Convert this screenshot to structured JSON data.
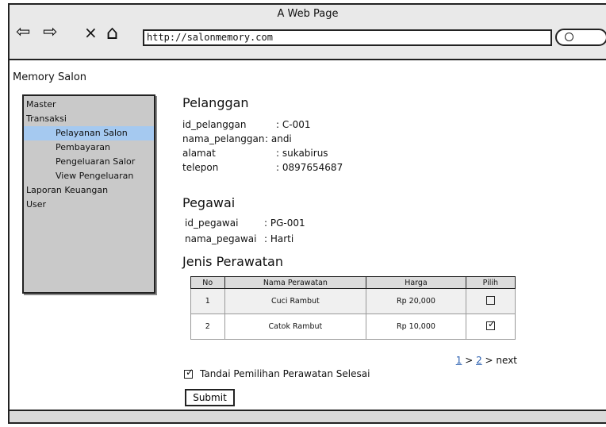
{
  "window": {
    "title": "A Web Page",
    "url": "http://salonmemory.com"
  },
  "icons": {
    "back": "arrow-left-icon",
    "forward": "arrow-right-icon",
    "stop": "close-icon",
    "home": "home-icon",
    "search": "search-icon"
  },
  "nav": {
    "back": "⇦",
    "forward": "⇨",
    "stop": "×",
    "home": "⌂"
  },
  "brand": "Memory Salon",
  "sidebar": {
    "items": [
      {
        "label": "Master"
      },
      {
        "label": "Transaksi"
      },
      {
        "label": "Pelayanan Salon"
      },
      {
        "label": "Pembayaran"
      },
      {
        "label": "Pengeluaran Salor"
      },
      {
        "label": "View Pengeluaran"
      },
      {
        "label": "Laporan Keuangan"
      },
      {
        "label": "User"
      }
    ],
    "selected_color": "#a5c9f0"
  },
  "pelanggan": {
    "heading": "Pelanggan",
    "fields": [
      {
        "key": "id_pelanggan",
        "value": ": C-001"
      },
      {
        "key": "nama_pelanggan",
        "value": ": andi"
      },
      {
        "key": "alamat",
        "value": ": sukabirus"
      },
      {
        "key": "telepon",
        "value": ": 0897654687"
      }
    ]
  },
  "pegawai": {
    "heading": "Pegawai",
    "fields": [
      {
        "key": "id_pegawai",
        "value": ": PG-001"
      },
      {
        "key": "nama_pegawai",
        "value": ": Harti"
      }
    ]
  },
  "perawatan": {
    "heading": "Jenis Perawatan",
    "columns": [
      "No",
      "Nama Perawatan",
      "Harga",
      "Pilih"
    ],
    "rows": [
      {
        "no": "1",
        "nama": "Cuci Rambut",
        "harga": "Rp 20,000",
        "checked": false
      },
      {
        "no": "2",
        "nama": "Catok Rambut",
        "harga": "Rp 10,000",
        "checked": true
      }
    ]
  },
  "pager": {
    "page1": "1",
    "sep": ">",
    "page2": "2",
    "next": "> next"
  },
  "confirm": {
    "label": "Tandai Pemilihan Perawatan Selesai",
    "checked": true
  },
  "submit_label": "Submit"
}
